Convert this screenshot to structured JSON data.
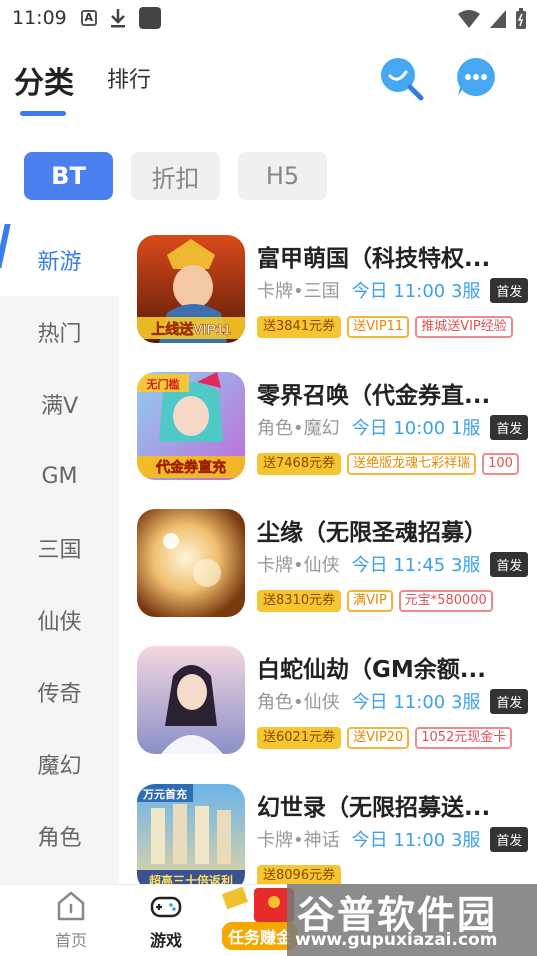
{
  "status_bar": {
    "time": "11:09",
    "notif_a": "A"
  },
  "header": {
    "tabs": [
      "分类",
      "排行"
    ]
  },
  "filters": [
    "BT",
    "折扣",
    "H5"
  ],
  "sidebar": {
    "items": [
      {
        "label": "新游"
      },
      {
        "label": "热门"
      },
      {
        "label": "满V"
      },
      {
        "label": "GM"
      },
      {
        "label": "三国"
      },
      {
        "label": "仙侠"
      },
      {
        "label": "传奇"
      },
      {
        "label": "魔幻"
      },
      {
        "label": "角色"
      }
    ]
  },
  "games": [
    {
      "title": "富甲萌国（科技特权...",
      "genre": "卡牌•三国",
      "time": "今日 11:00 3服",
      "badge": "首发",
      "icon_text": "上线送VIP11",
      "tags": [
        "送3841元券",
        "送VIP11",
        "推城送VIP经验"
      ]
    },
    {
      "title": "零界召唤（代金券直...",
      "genre": "角色•魔幻",
      "time": "今日 10:00 1服",
      "badge": "首发",
      "icon_text": "代金券直充",
      "icon_text2": "无门槛",
      "tags": [
        "送7468元券",
        "送绝版龙魂七彩祥瑞",
        "100"
      ]
    },
    {
      "title": "尘缘（无限圣魂招募）",
      "genre": "卡牌•仙侠",
      "time": "今日 11:45 3服",
      "badge": "首发",
      "tags": [
        "送8310元券",
        "满VIP",
        "元宝*580000"
      ]
    },
    {
      "title": "白蛇仙劫（GM余额...",
      "genre": "角色•仙侠",
      "time": "今日 11:00 3服",
      "badge": "首发",
      "tags": [
        "送6021元券",
        "送VIP20",
        "1052元现金卡"
      ]
    },
    {
      "title": "幻世录（无限招募送...",
      "genre": "卡牌•神话",
      "time": "今日 11:00 3服",
      "badge": "首发",
      "icon_text": "超高三十倍返利",
      "icon_text2": "万元首充",
      "tags": [
        "送8096元券"
      ]
    }
  ],
  "bottom_nav": {
    "home": "首页",
    "game": "游戏",
    "task": "任务赚金"
  },
  "watermark": {
    "main": "谷普软件园",
    "url": "www.gupuxiazai.com"
  },
  "colors": {
    "accent": "#3b7cf0",
    "voucher": "#f7c531",
    "time_blue": "#3ba1ee"
  }
}
